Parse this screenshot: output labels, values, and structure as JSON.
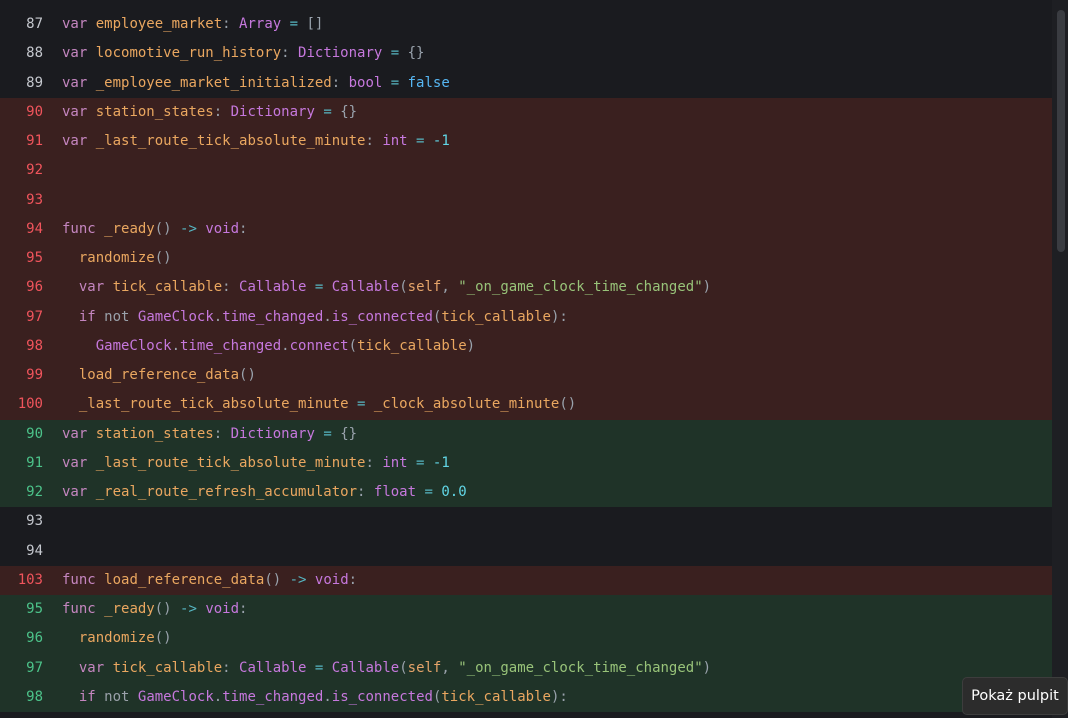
{
  "tooltip": {
    "text": "Pokaż pulpit"
  },
  "diff_lines": [
    {
      "n": "87",
      "state": "context",
      "tokens": [
        [
          "kw",
          "var"
        ],
        [
          "",
          ""
        ],
        [
          "var",
          "employee_market"
        ],
        [
          "punct",
          ": "
        ],
        [
          "typ",
          "Array"
        ],
        [
          "op",
          " = "
        ],
        [
          "punct",
          "[]"
        ]
      ]
    },
    {
      "n": "88",
      "state": "context",
      "tokens": [
        [
          "kw",
          "var"
        ],
        [
          "",
          ""
        ],
        [
          "var",
          "locomotive_run_history"
        ],
        [
          "punct",
          ": "
        ],
        [
          "typ",
          "Dictionary"
        ],
        [
          "op",
          " = "
        ],
        [
          "punct",
          "{}"
        ]
      ]
    },
    {
      "n": "89",
      "state": "context",
      "tokens": [
        [
          "kw",
          "var"
        ],
        [
          "",
          ""
        ],
        [
          "var",
          "_employee_market_initialized"
        ],
        [
          "punct",
          ": "
        ],
        [
          "typ",
          "bool"
        ],
        [
          "op",
          " = "
        ],
        [
          "lit",
          "false"
        ]
      ]
    },
    {
      "n": "90",
      "state": "removed",
      "tokens": [
        [
          "kw",
          "var"
        ],
        [
          "",
          ""
        ],
        [
          "var",
          "station_states"
        ],
        [
          "punct",
          ": "
        ],
        [
          "typ",
          "Dictionary"
        ],
        [
          "op",
          " = "
        ],
        [
          "punct",
          "{}"
        ]
      ]
    },
    {
      "n": "91",
      "state": "removed",
      "tokens": [
        [
          "kw",
          "var"
        ],
        [
          "",
          ""
        ],
        [
          "var",
          "_last_route_tick_absolute_minute"
        ],
        [
          "punct",
          ": "
        ],
        [
          "typ",
          "int"
        ],
        [
          "op",
          " = "
        ],
        [
          "num",
          "-1"
        ]
      ]
    },
    {
      "n": "92",
      "state": "removed",
      "tokens": []
    },
    {
      "n": "93",
      "state": "removed",
      "tokens": []
    },
    {
      "n": "94",
      "state": "removed",
      "tokens": [
        [
          "kw",
          "func"
        ],
        [
          "",
          ""
        ],
        [
          "var",
          "_ready"
        ],
        [
          "punct",
          "() "
        ],
        [
          "op",
          "->"
        ],
        [
          "",
          ""
        ],
        [
          "typ",
          "void"
        ],
        [
          "punct",
          ":"
        ]
      ]
    },
    {
      "n": "95",
      "state": "removed",
      "tokens": [
        [
          "",
          "  "
        ],
        [
          "var",
          "randomize"
        ],
        [
          "punct",
          "()"
        ]
      ]
    },
    {
      "n": "96",
      "state": "removed",
      "tokens": [
        [
          "",
          "  "
        ],
        [
          "kw",
          "var"
        ],
        [
          "",
          ""
        ],
        [
          "var",
          "tick_callable"
        ],
        [
          "punct",
          ": "
        ],
        [
          "typ",
          "Callable"
        ],
        [
          "op",
          " = "
        ],
        [
          "typ",
          "Callable"
        ],
        [
          "punct",
          "("
        ],
        [
          "self",
          "self"
        ],
        [
          "punct",
          ", "
        ],
        [
          "str",
          "\"_on_game_clock_time_changed\""
        ],
        [
          "punct",
          ")"
        ]
      ]
    },
    {
      "n": "97",
      "state": "removed",
      "tokens": [
        [
          "",
          "  "
        ],
        [
          "kw",
          "if"
        ],
        [
          "",
          ""
        ],
        [
          "kw2",
          "not"
        ],
        [
          "",
          ""
        ],
        [
          "typ",
          "GameClock"
        ],
        [
          "punct",
          "."
        ],
        [
          "prop",
          "time_changed"
        ],
        [
          "punct",
          "."
        ],
        [
          "prop",
          "is_connected"
        ],
        [
          "punct",
          "("
        ],
        [
          "var",
          "tick_callable"
        ],
        [
          "punct",
          "):"
        ]
      ]
    },
    {
      "n": "98",
      "state": "removed",
      "tokens": [
        [
          "",
          "    "
        ],
        [
          "typ",
          "GameClock"
        ],
        [
          "punct",
          "."
        ],
        [
          "prop",
          "time_changed"
        ],
        [
          "punct",
          "."
        ],
        [
          "prop",
          "connect"
        ],
        [
          "punct",
          "("
        ],
        [
          "var",
          "tick_callable"
        ],
        [
          "punct",
          ")"
        ]
      ]
    },
    {
      "n": "99",
      "state": "removed",
      "tokens": [
        [
          "",
          "  "
        ],
        [
          "var",
          "load_reference_data"
        ],
        [
          "punct",
          "()"
        ]
      ]
    },
    {
      "n": "100",
      "state": "removed",
      "tokens": [
        [
          "",
          "  "
        ],
        [
          "var",
          "_last_route_tick_absolute_minute"
        ],
        [
          "op",
          " = "
        ],
        [
          "var",
          "_clock_absolute_minute"
        ],
        [
          "punct",
          "()"
        ]
      ]
    },
    {
      "n": "90",
      "state": "added",
      "tokens": [
        [
          "kw",
          "var"
        ],
        [
          "",
          ""
        ],
        [
          "var",
          "station_states"
        ],
        [
          "punct",
          ": "
        ],
        [
          "typ",
          "Dictionary"
        ],
        [
          "op",
          " = "
        ],
        [
          "punct",
          "{}"
        ]
      ]
    },
    {
      "n": "91",
      "state": "added",
      "tokens": [
        [
          "kw",
          "var"
        ],
        [
          "",
          ""
        ],
        [
          "var",
          "_last_route_tick_absolute_minute"
        ],
        [
          "punct",
          ": "
        ],
        [
          "typ",
          "int"
        ],
        [
          "op",
          " = "
        ],
        [
          "num",
          "-1"
        ]
      ]
    },
    {
      "n": "92",
      "state": "added",
      "tokens": [
        [
          "kw",
          "var"
        ],
        [
          "",
          ""
        ],
        [
          "var",
          "_real_route_refresh_accumulator"
        ],
        [
          "punct",
          ": "
        ],
        [
          "typ",
          "float"
        ],
        [
          "op",
          " = "
        ],
        [
          "num",
          "0.0"
        ]
      ]
    },
    {
      "n": "93",
      "state": "context",
      "tokens": []
    },
    {
      "n": "94",
      "state": "context",
      "tokens": []
    },
    {
      "n": "103",
      "state": "removed",
      "tokens": [
        [
          "kw",
          "func"
        ],
        [
          "",
          ""
        ],
        [
          "var",
          "load_reference_data"
        ],
        [
          "punct",
          "() "
        ],
        [
          "op",
          "->"
        ],
        [
          "",
          ""
        ],
        [
          "typ",
          "void"
        ],
        [
          "punct",
          ":"
        ]
      ]
    },
    {
      "n": "95",
      "state": "added",
      "tokens": [
        [
          "kw",
          "func"
        ],
        [
          "",
          ""
        ],
        [
          "var",
          "_ready"
        ],
        [
          "punct",
          "() "
        ],
        [
          "op",
          "->"
        ],
        [
          "",
          ""
        ],
        [
          "typ",
          "void"
        ],
        [
          "punct",
          ":"
        ]
      ]
    },
    {
      "n": "96",
      "state": "added",
      "tokens": [
        [
          "",
          "  "
        ],
        [
          "var",
          "randomize"
        ],
        [
          "punct",
          "()"
        ]
      ]
    },
    {
      "n": "97",
      "state": "added",
      "tokens": [
        [
          "",
          "  "
        ],
        [
          "kw",
          "var"
        ],
        [
          "",
          ""
        ],
        [
          "var",
          "tick_callable"
        ],
        [
          "punct",
          ": "
        ],
        [
          "typ",
          "Callable"
        ],
        [
          "op",
          " = "
        ],
        [
          "typ",
          "Callable"
        ],
        [
          "punct",
          "("
        ],
        [
          "self",
          "self"
        ],
        [
          "punct",
          ", "
        ],
        [
          "str",
          "\"_on_game_clock_time_changed\""
        ],
        [
          "punct",
          ")"
        ]
      ]
    },
    {
      "n": "98",
      "state": "added",
      "tokens": [
        [
          "",
          "  "
        ],
        [
          "kw",
          "if"
        ],
        [
          "",
          ""
        ],
        [
          "kw2",
          "not"
        ],
        [
          "",
          ""
        ],
        [
          "typ",
          "GameClock"
        ],
        [
          "punct",
          "."
        ],
        [
          "prop",
          "time_changed"
        ],
        [
          "punct",
          "."
        ],
        [
          "prop",
          "is_connected"
        ],
        [
          "punct",
          "("
        ],
        [
          "var",
          "tick_callable"
        ],
        [
          "punct",
          "):"
        ]
      ]
    }
  ]
}
